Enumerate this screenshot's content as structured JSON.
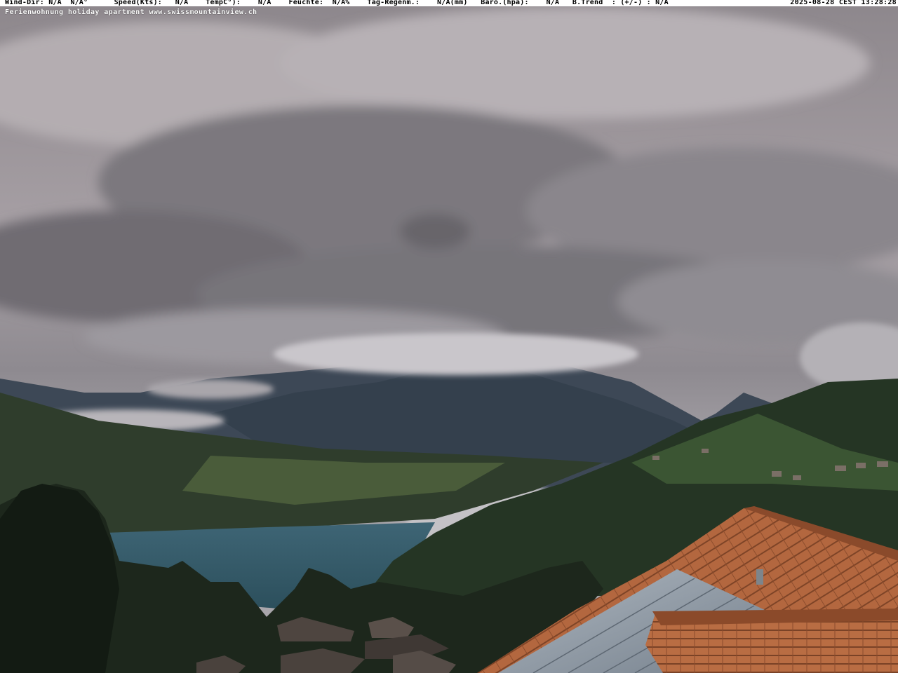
{
  "overlay": {
    "wind_dir_label": "Wind-Dir:",
    "wind_dir_value": "N/A",
    "wind_deg_value": "N/A°",
    "speed_label": "Speed(Kts):",
    "speed_value": "N/A",
    "temp_label": "TempC°):",
    "temp_value": "N/A",
    "humidity_label": "Feuchte:",
    "humidity_value": "N/A%",
    "rain_label": "Tag-Regenm.:",
    "rain_value": "N/A(mm)",
    "baro_label": "Baro.(hpa):",
    "baro_value": "N/A",
    "trend_label": "B.Trend  : (+/-) :",
    "trend_value": "N/A",
    "timestamp": "2025-08-28 CEST 13:28:28",
    "caption": "Ferienwohnung holiday apartment www.swissmountainview.ch"
  },
  "colors": {
    "sky_light": "#b9b2b6",
    "sky_dark": "#4c4b50",
    "lake": "#345866",
    "mountain": "#3b4756",
    "forest": "#1f2a1f",
    "roof_tile": "#b0643d",
    "solar_panel": "#8f9aa6"
  }
}
